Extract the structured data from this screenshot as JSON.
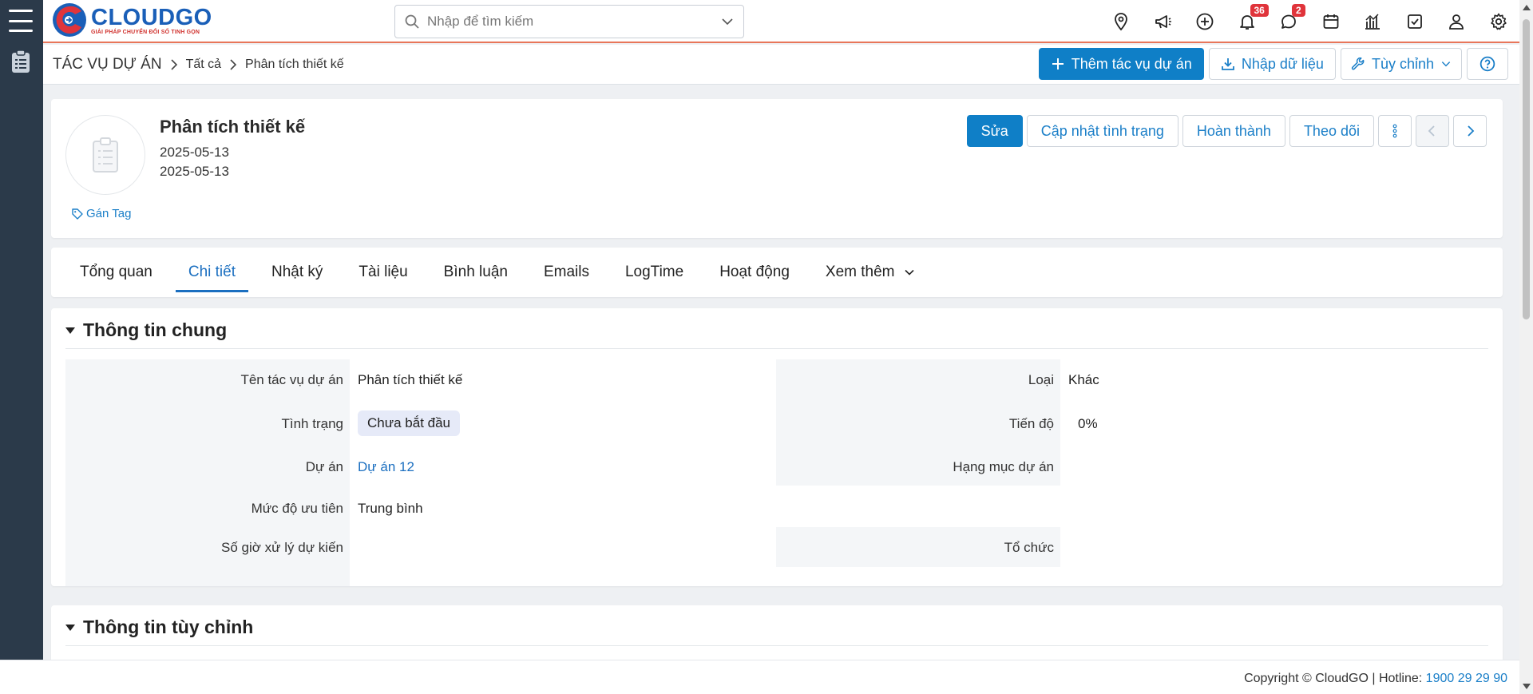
{
  "brand": {
    "name": "CLOUDGO",
    "slogan": "GIẢI PHÁP CHUYỂN ĐỔI SỐ TINH GỌN"
  },
  "search": {
    "placeholder": "Nhập để tìm kiếm"
  },
  "header_icons": [
    "map-pin-icon",
    "megaphone-icon",
    "plus-circle-icon",
    "bell-icon",
    "chat-icon",
    "calendar-icon",
    "chart-icon",
    "checkbox-icon",
    "user-icon",
    "gear-icon"
  ],
  "badges": {
    "notifications": "36",
    "messages": "2"
  },
  "breadcrumb": {
    "root": "TÁC VỤ DỰ ÁN",
    "level1": "Tất cả",
    "level2": "Phân tích thiết kế"
  },
  "toolbar": {
    "add_label": "Thêm tác vụ dự án",
    "import_label": "Nhập dữ liệu",
    "customize_label": "Tùy chỉnh"
  },
  "record": {
    "title": "Phân tích thiết kế",
    "date_start": "2025-05-13",
    "date_end": "2025-05-13",
    "tag_label": "Gán Tag",
    "actions": {
      "edit": "Sửa",
      "update_status": "Cập nhật tình trạng",
      "complete": "Hoàn thành",
      "follow": "Theo dõi"
    }
  },
  "tabs": [
    {
      "label": "Tổng quan",
      "active": false
    },
    {
      "label": "Chi tiết",
      "active": true
    },
    {
      "label": "Nhật ký",
      "active": false
    },
    {
      "label": "Tài liệu",
      "active": false
    },
    {
      "label": "Bình luận",
      "active": false
    },
    {
      "label": "Emails",
      "active": false
    },
    {
      "label": "LogTime",
      "active": false
    },
    {
      "label": "Hoạt động",
      "active": false
    },
    {
      "label": "Xem thêm",
      "active": false
    }
  ],
  "general": {
    "title": "Thông tin chung",
    "fields": {
      "name": {
        "label": "Tên tác vụ dự án",
        "value": "Phân tích thiết kế"
      },
      "type": {
        "label": "Loại",
        "value": "Khác"
      },
      "status": {
        "label": "Tình trạng",
        "value": "Chưa bắt đầu"
      },
      "progress": {
        "label": "Tiến độ",
        "value": "0%"
      },
      "project": {
        "label": "Dự án",
        "value": "Dự án 12"
      },
      "project_item": {
        "label": "Hạng mục dự án",
        "value": ""
      },
      "priority": {
        "label": "Mức độ ưu tiên",
        "value": "Trung bình"
      },
      "hours": {
        "label": "Số giờ xử lý dự kiến",
        "value": ""
      },
      "org": {
        "label": "Tổ chức",
        "value": ""
      }
    }
  },
  "custom": {
    "title": "Thông tin tùy chỉnh"
  },
  "footer": {
    "copyright": "Copyright © CloudGO",
    "hotline_label": "Hotline:",
    "hotline": "1900 29 29 90"
  },
  "colors": {
    "primary": "#0f7fc7",
    "header_accent": "#e8765a",
    "rail": "#2b3a4a",
    "badge": "#e0343b"
  }
}
